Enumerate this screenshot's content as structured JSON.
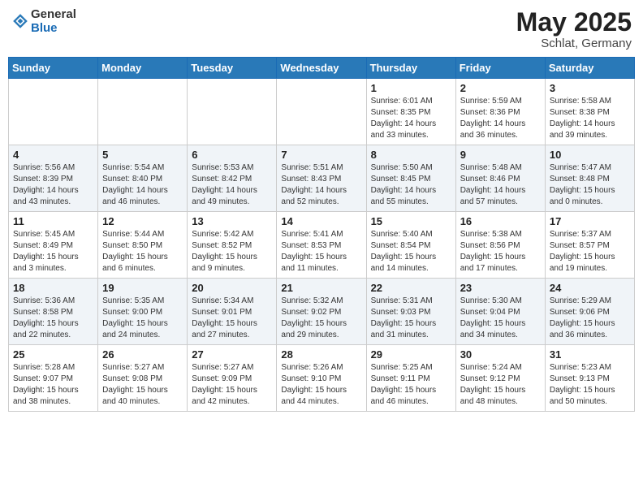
{
  "header": {
    "logo_general": "General",
    "logo_blue": "Blue",
    "month_year": "May 2025",
    "location": "Schlat, Germany"
  },
  "weekdays": [
    "Sunday",
    "Monday",
    "Tuesday",
    "Wednesday",
    "Thursday",
    "Friday",
    "Saturday"
  ],
  "weeks": [
    [
      {
        "day": "",
        "info": ""
      },
      {
        "day": "",
        "info": ""
      },
      {
        "day": "",
        "info": ""
      },
      {
        "day": "",
        "info": ""
      },
      {
        "day": "1",
        "info": "Sunrise: 6:01 AM\nSunset: 8:35 PM\nDaylight: 14 hours\nand 33 minutes."
      },
      {
        "day": "2",
        "info": "Sunrise: 5:59 AM\nSunset: 8:36 PM\nDaylight: 14 hours\nand 36 minutes."
      },
      {
        "day": "3",
        "info": "Sunrise: 5:58 AM\nSunset: 8:38 PM\nDaylight: 14 hours\nand 39 minutes."
      }
    ],
    [
      {
        "day": "4",
        "info": "Sunrise: 5:56 AM\nSunset: 8:39 PM\nDaylight: 14 hours\nand 43 minutes."
      },
      {
        "day": "5",
        "info": "Sunrise: 5:54 AM\nSunset: 8:40 PM\nDaylight: 14 hours\nand 46 minutes."
      },
      {
        "day": "6",
        "info": "Sunrise: 5:53 AM\nSunset: 8:42 PM\nDaylight: 14 hours\nand 49 minutes."
      },
      {
        "day": "7",
        "info": "Sunrise: 5:51 AM\nSunset: 8:43 PM\nDaylight: 14 hours\nand 52 minutes."
      },
      {
        "day": "8",
        "info": "Sunrise: 5:50 AM\nSunset: 8:45 PM\nDaylight: 14 hours\nand 55 minutes."
      },
      {
        "day": "9",
        "info": "Sunrise: 5:48 AM\nSunset: 8:46 PM\nDaylight: 14 hours\nand 57 minutes."
      },
      {
        "day": "10",
        "info": "Sunrise: 5:47 AM\nSunset: 8:48 PM\nDaylight: 15 hours\nand 0 minutes."
      }
    ],
    [
      {
        "day": "11",
        "info": "Sunrise: 5:45 AM\nSunset: 8:49 PM\nDaylight: 15 hours\nand 3 minutes."
      },
      {
        "day": "12",
        "info": "Sunrise: 5:44 AM\nSunset: 8:50 PM\nDaylight: 15 hours\nand 6 minutes."
      },
      {
        "day": "13",
        "info": "Sunrise: 5:42 AM\nSunset: 8:52 PM\nDaylight: 15 hours\nand 9 minutes."
      },
      {
        "day": "14",
        "info": "Sunrise: 5:41 AM\nSunset: 8:53 PM\nDaylight: 15 hours\nand 11 minutes."
      },
      {
        "day": "15",
        "info": "Sunrise: 5:40 AM\nSunset: 8:54 PM\nDaylight: 15 hours\nand 14 minutes."
      },
      {
        "day": "16",
        "info": "Sunrise: 5:38 AM\nSunset: 8:56 PM\nDaylight: 15 hours\nand 17 minutes."
      },
      {
        "day": "17",
        "info": "Sunrise: 5:37 AM\nSunset: 8:57 PM\nDaylight: 15 hours\nand 19 minutes."
      }
    ],
    [
      {
        "day": "18",
        "info": "Sunrise: 5:36 AM\nSunset: 8:58 PM\nDaylight: 15 hours\nand 22 minutes."
      },
      {
        "day": "19",
        "info": "Sunrise: 5:35 AM\nSunset: 9:00 PM\nDaylight: 15 hours\nand 24 minutes."
      },
      {
        "day": "20",
        "info": "Sunrise: 5:34 AM\nSunset: 9:01 PM\nDaylight: 15 hours\nand 27 minutes."
      },
      {
        "day": "21",
        "info": "Sunrise: 5:32 AM\nSunset: 9:02 PM\nDaylight: 15 hours\nand 29 minutes."
      },
      {
        "day": "22",
        "info": "Sunrise: 5:31 AM\nSunset: 9:03 PM\nDaylight: 15 hours\nand 31 minutes."
      },
      {
        "day": "23",
        "info": "Sunrise: 5:30 AM\nSunset: 9:04 PM\nDaylight: 15 hours\nand 34 minutes."
      },
      {
        "day": "24",
        "info": "Sunrise: 5:29 AM\nSunset: 9:06 PM\nDaylight: 15 hours\nand 36 minutes."
      }
    ],
    [
      {
        "day": "25",
        "info": "Sunrise: 5:28 AM\nSunset: 9:07 PM\nDaylight: 15 hours\nand 38 minutes."
      },
      {
        "day": "26",
        "info": "Sunrise: 5:27 AM\nSunset: 9:08 PM\nDaylight: 15 hours\nand 40 minutes."
      },
      {
        "day": "27",
        "info": "Sunrise: 5:27 AM\nSunset: 9:09 PM\nDaylight: 15 hours\nand 42 minutes."
      },
      {
        "day": "28",
        "info": "Sunrise: 5:26 AM\nSunset: 9:10 PM\nDaylight: 15 hours\nand 44 minutes."
      },
      {
        "day": "29",
        "info": "Sunrise: 5:25 AM\nSunset: 9:11 PM\nDaylight: 15 hours\nand 46 minutes."
      },
      {
        "day": "30",
        "info": "Sunrise: 5:24 AM\nSunset: 9:12 PM\nDaylight: 15 hours\nand 48 minutes."
      },
      {
        "day": "31",
        "info": "Sunrise: 5:23 AM\nSunset: 9:13 PM\nDaylight: 15 hours\nand 50 minutes."
      }
    ]
  ]
}
